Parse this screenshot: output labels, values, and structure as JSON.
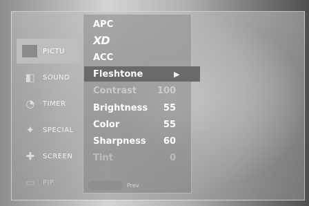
{
  "sidebar": {
    "items": [
      {
        "label": "PICTU",
        "icon": "picture-icon",
        "active": true
      },
      {
        "label": "SOUND",
        "icon": "speaker-icon",
        "active": false
      },
      {
        "label": "TIMER",
        "icon": "clock-icon",
        "active": false
      },
      {
        "label": "SPECIAL",
        "icon": "special-icon",
        "active": false
      },
      {
        "label": "SCREEN",
        "icon": "screen-icon",
        "active": false
      },
      {
        "label": "PIP",
        "icon": "pip-icon",
        "active": false
      }
    ]
  },
  "menu": {
    "items": [
      {
        "label": "APC",
        "value": ""
      },
      {
        "label": "XD",
        "value": ""
      },
      {
        "label": "ACC",
        "value": ""
      },
      {
        "label": "Fleshtone",
        "value": "",
        "arrow": "▶"
      },
      {
        "label": "Contrast",
        "value": "100"
      },
      {
        "label": "Brightness",
        "value": "55"
      },
      {
        "label": "Color",
        "value": "55"
      },
      {
        "label": "Sharpness",
        "value": "60"
      },
      {
        "label": "Tint",
        "value": "0"
      }
    ]
  },
  "footer": {
    "prev_label": "Prev."
  }
}
